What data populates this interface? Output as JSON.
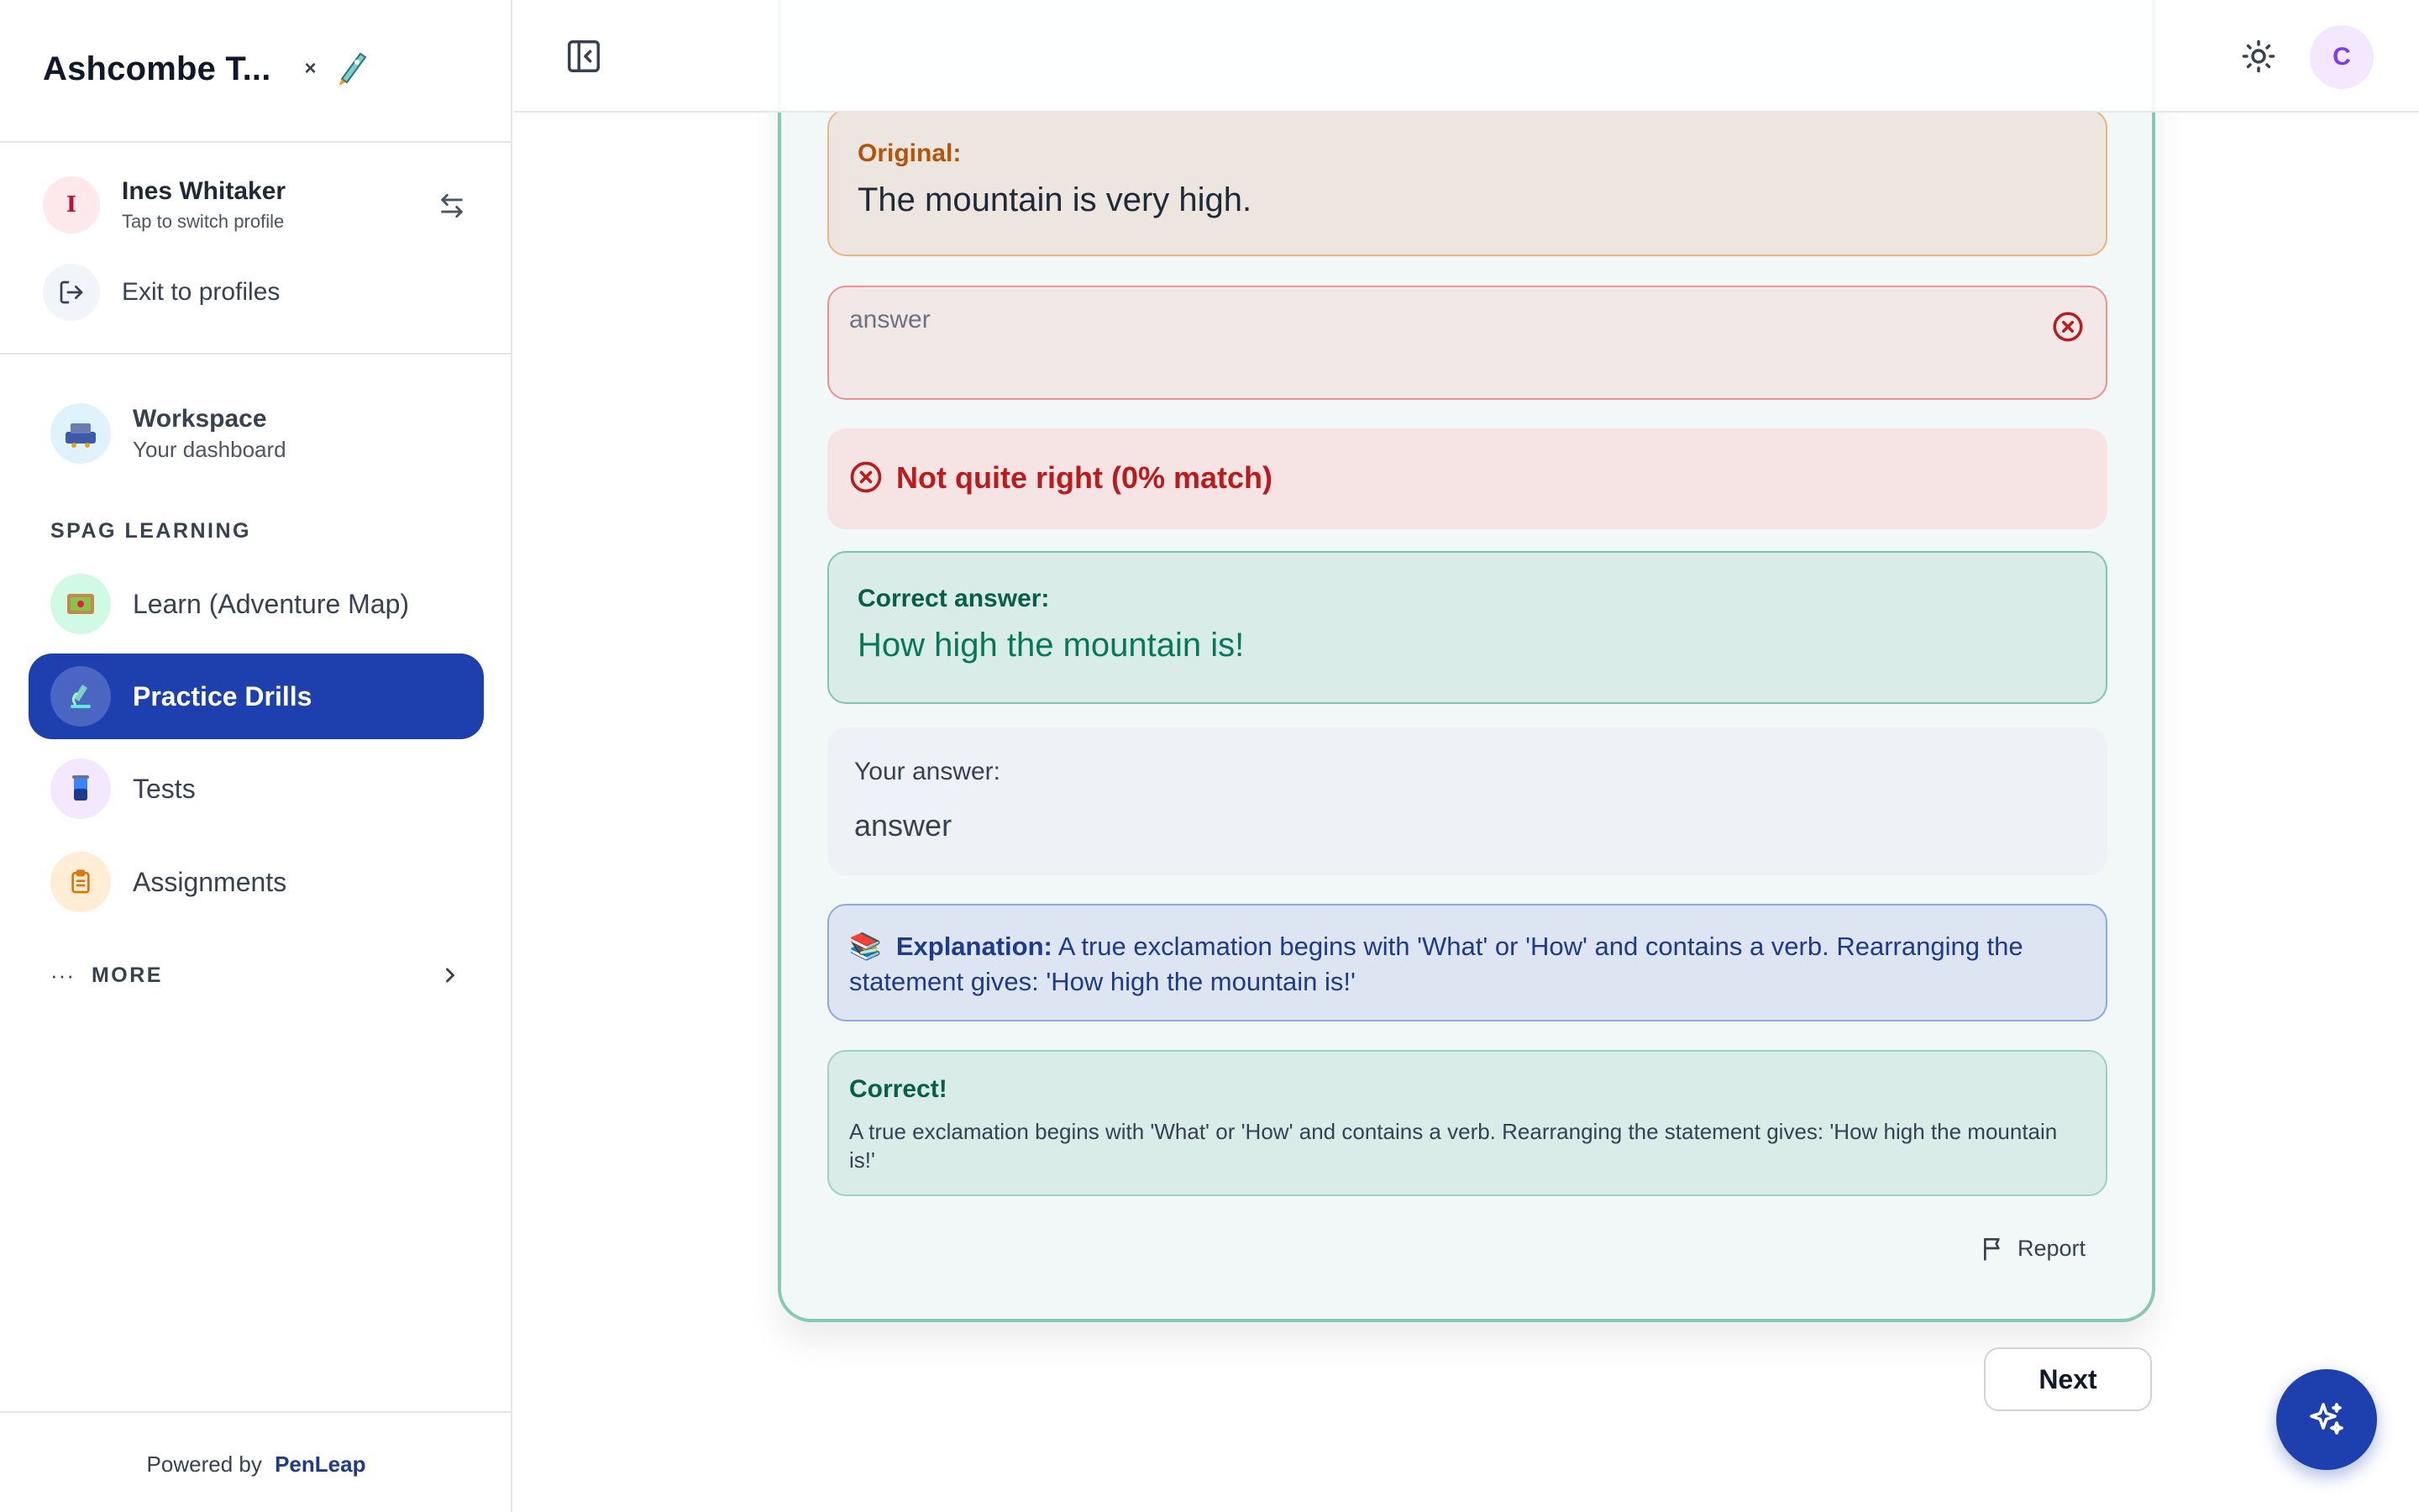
{
  "sidebar": {
    "brand_title": "Ashcombe T...",
    "brand_close": "×",
    "profile": {
      "initial": "I",
      "name": "Ines Whitaker",
      "subtitle": "Tap to switch profile"
    },
    "exit_label": "Exit to profiles",
    "workspace": {
      "label": "Workspace",
      "sub": "Your dashboard"
    },
    "section_label": "SPAG LEARNING",
    "items": [
      {
        "label": "Learn (Adventure Map)"
      },
      {
        "label": "Practice Drills"
      },
      {
        "label": "Tests"
      },
      {
        "label": "Assignments"
      }
    ],
    "more_dots": "···",
    "more_label": "MORE",
    "powered_prefix": "Powered by",
    "powered_brand": "PenLeap"
  },
  "header": {
    "user_initial": "C"
  },
  "exercise": {
    "original_label": "Original:",
    "original_text": "The mountain is very high.",
    "answer_value": "answer",
    "result_text": "Not quite right (0% match)",
    "correct_label": "Correct answer:",
    "correct_text": "How high the mountain is!",
    "your_label": "Your answer:",
    "your_text": "answer",
    "explanation_icon": "📚",
    "explanation_label": "Explanation:",
    "explanation_text": " A true exclamation begins with 'What' or 'How' and contains a verb. Rearranging the statement gives: 'How high the mountain is!'",
    "feedback_title": "Correct!",
    "feedback_text": "A true exclamation begins with 'What' or 'How' and contains a verb. Rearranging the statement gives: 'How high the mountain is!'",
    "report_label": "Report",
    "next_label": "Next"
  },
  "colors": {
    "accent": "#1e40af",
    "card_border": "#86c8b4",
    "error": "#b91c1c",
    "success": "#047857"
  }
}
